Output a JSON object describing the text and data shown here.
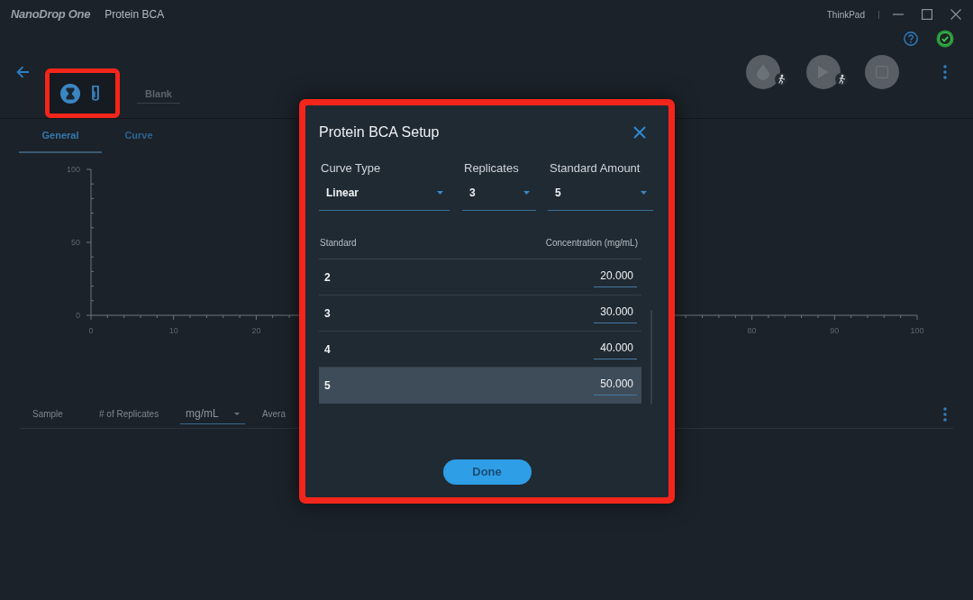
{
  "window": {
    "logo": "NanoDrop One",
    "title": "Protein BCA",
    "device": "ThinkPad"
  },
  "toolbar": {
    "highlighted": true,
    "sample_types": [
      {
        "kind": "hourglass",
        "selected": true
      },
      {
        "kind": "tube",
        "selected": false
      }
    ],
    "blank_button": {
      "label": "Blank",
      "disabled": true
    },
    "instrument_buttons": [
      {
        "kind": "drop",
        "auto": true,
        "disabled": true
      },
      {
        "kind": "play",
        "auto": true,
        "disabled": true
      },
      {
        "kind": "stop",
        "auto": false,
        "disabled": true
      }
    ]
  },
  "tabs": [
    {
      "label": "General",
      "selected": true
    },
    {
      "label": "Curve",
      "selected": false
    }
  ],
  "chart": {
    "chart_data": {
      "type": "scatter",
      "xlim": [
        0,
        100
      ],
      "ylim": [
        0,
        100
      ],
      "xticks": [
        0,
        10,
        20,
        80,
        90,
        100
      ],
      "yticks": [
        0,
        50,
        100
      ]
    }
  },
  "results_table": {
    "columns": [
      {
        "kind": "text",
        "label": "Sample"
      },
      {
        "kind": "text",
        "label": "# of Replicates"
      },
      {
        "kind": "dropdown",
        "label": "mg/mL"
      },
      {
        "kind": "text",
        "label": "Avera"
      }
    ]
  },
  "dialog": {
    "title": "Protein BCA Setup",
    "highlighted": true,
    "fields": [
      {
        "label": "Curve Type",
        "value": "Linear"
      },
      {
        "label": "Replicates",
        "value": "3"
      },
      {
        "label": "Standard Amount",
        "value": "5"
      }
    ],
    "table": {
      "columns": [
        "Standard",
        "Concentration (mg/mL)"
      ],
      "rows": [
        {
          "standard": "2",
          "concentration": "20.000",
          "selected": false
        },
        {
          "standard": "3",
          "concentration": "30.000",
          "selected": false
        },
        {
          "standard": "4",
          "concentration": "40.000",
          "selected": false
        },
        {
          "standard": "5",
          "concentration": "50.000",
          "selected": true
        }
      ]
    },
    "done_button": "Done"
  }
}
